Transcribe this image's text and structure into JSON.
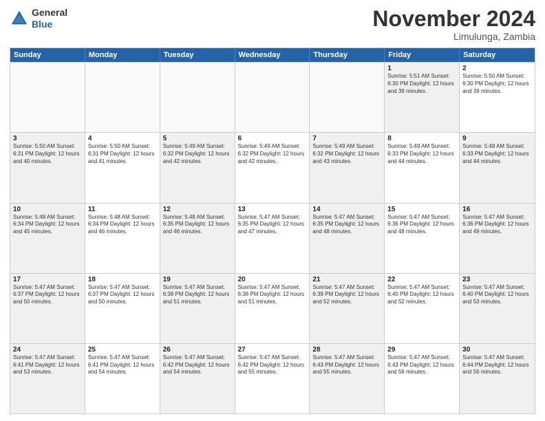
{
  "header": {
    "logo_general": "General",
    "logo_blue": "Blue",
    "month_title": "November 2024",
    "location": "Limulunga, Zambia"
  },
  "weekdays": [
    "Sunday",
    "Monday",
    "Tuesday",
    "Wednesday",
    "Thursday",
    "Friday",
    "Saturday"
  ],
  "rows": [
    [
      {
        "day": "",
        "text": "",
        "empty": true
      },
      {
        "day": "",
        "text": "",
        "empty": true
      },
      {
        "day": "",
        "text": "",
        "empty": true
      },
      {
        "day": "",
        "text": "",
        "empty": true
      },
      {
        "day": "",
        "text": "",
        "empty": true
      },
      {
        "day": "1",
        "text": "Sunrise: 5:51 AM\nSunset: 6:30 PM\nDaylight: 12 hours\nand 39 minutes.",
        "shaded": true
      },
      {
        "day": "2",
        "text": "Sunrise: 5:50 AM\nSunset: 6:30 PM\nDaylight: 12 hours\nand 39 minutes.",
        "shaded": false
      }
    ],
    [
      {
        "day": "3",
        "text": "Sunrise: 5:50 AM\nSunset: 6:31 PM\nDaylight: 12 hours\nand 40 minutes.",
        "shaded": true
      },
      {
        "day": "4",
        "text": "Sunrise: 5:50 AM\nSunset: 6:31 PM\nDaylight: 12 hours\nand 41 minutes.",
        "shaded": false
      },
      {
        "day": "5",
        "text": "Sunrise: 5:49 AM\nSunset: 6:32 PM\nDaylight: 12 hours\nand 42 minutes.",
        "shaded": true
      },
      {
        "day": "6",
        "text": "Sunrise: 5:49 AM\nSunset: 6:32 PM\nDaylight: 12 hours\nand 42 minutes.",
        "shaded": false
      },
      {
        "day": "7",
        "text": "Sunrise: 5:49 AM\nSunset: 6:32 PM\nDaylight: 12 hours\nand 43 minutes.",
        "shaded": true
      },
      {
        "day": "8",
        "text": "Sunrise: 5:49 AM\nSunset: 6:33 PM\nDaylight: 12 hours\nand 44 minutes.",
        "shaded": false
      },
      {
        "day": "9",
        "text": "Sunrise: 5:48 AM\nSunset: 6:33 PM\nDaylight: 12 hours\nand 44 minutes.",
        "shaded": true
      }
    ],
    [
      {
        "day": "10",
        "text": "Sunrise: 5:48 AM\nSunset: 6:34 PM\nDaylight: 12 hours\nand 45 minutes.",
        "shaded": true
      },
      {
        "day": "11",
        "text": "Sunrise: 5:48 AM\nSunset: 6:34 PM\nDaylight: 12 hours\nand 46 minutes.",
        "shaded": false
      },
      {
        "day": "12",
        "text": "Sunrise: 5:48 AM\nSunset: 6:35 PM\nDaylight: 12 hours\nand 46 minutes.",
        "shaded": true
      },
      {
        "day": "13",
        "text": "Sunrise: 5:47 AM\nSunset: 6:35 PM\nDaylight: 12 hours\nand 47 minutes.",
        "shaded": false
      },
      {
        "day": "14",
        "text": "Sunrise: 5:47 AM\nSunset: 6:35 PM\nDaylight: 12 hours\nand 48 minutes.",
        "shaded": true
      },
      {
        "day": "15",
        "text": "Sunrise: 5:47 AM\nSunset: 6:36 PM\nDaylight: 12 hours\nand 48 minutes.",
        "shaded": false
      },
      {
        "day": "16",
        "text": "Sunrise: 5:47 AM\nSunset: 6:36 PM\nDaylight: 12 hours\nand 49 minutes.",
        "shaded": true
      }
    ],
    [
      {
        "day": "17",
        "text": "Sunrise: 5:47 AM\nSunset: 6:37 PM\nDaylight: 12 hours\nand 50 minutes.",
        "shaded": true
      },
      {
        "day": "18",
        "text": "Sunrise: 5:47 AM\nSunset: 6:37 PM\nDaylight: 12 hours\nand 50 minutes.",
        "shaded": false
      },
      {
        "day": "19",
        "text": "Sunrise: 5:47 AM\nSunset: 6:38 PM\nDaylight: 12 hours\nand 51 minutes.",
        "shaded": true
      },
      {
        "day": "20",
        "text": "Sunrise: 5:47 AM\nSunset: 6:38 PM\nDaylight: 12 hours\nand 51 minutes.",
        "shaded": false
      },
      {
        "day": "21",
        "text": "Sunrise: 5:47 AM\nSunset: 6:39 PM\nDaylight: 12 hours\nand 52 minutes.",
        "shaded": true
      },
      {
        "day": "22",
        "text": "Sunrise: 5:47 AM\nSunset: 6:40 PM\nDaylight: 12 hours\nand 52 minutes.",
        "shaded": false
      },
      {
        "day": "23",
        "text": "Sunrise: 5:47 AM\nSunset: 6:40 PM\nDaylight: 12 hours\nand 53 minutes.",
        "shaded": true
      }
    ],
    [
      {
        "day": "24",
        "text": "Sunrise: 5:47 AM\nSunset: 6:41 PM\nDaylight: 12 hours\nand 53 minutes.",
        "shaded": true
      },
      {
        "day": "25",
        "text": "Sunrise: 5:47 AM\nSunset: 6:41 PM\nDaylight: 12 hours\nand 54 minutes.",
        "shaded": false
      },
      {
        "day": "26",
        "text": "Sunrise: 5:47 AM\nSunset: 6:42 PM\nDaylight: 12 hours\nand 54 minutes.",
        "shaded": true
      },
      {
        "day": "27",
        "text": "Sunrise: 5:47 AM\nSunset: 6:42 PM\nDaylight: 12 hours\nand 55 minutes.",
        "shaded": false
      },
      {
        "day": "28",
        "text": "Sunrise: 5:47 AM\nSunset: 6:43 PM\nDaylight: 12 hours\nand 55 minutes.",
        "shaded": true
      },
      {
        "day": "29",
        "text": "Sunrise: 5:47 AM\nSunset: 6:43 PM\nDaylight: 12 hours\nand 56 minutes.",
        "shaded": false
      },
      {
        "day": "30",
        "text": "Sunrise: 5:47 AM\nSunset: 6:44 PM\nDaylight: 12 hours\nand 56 minutes.",
        "shaded": true
      }
    ]
  ]
}
